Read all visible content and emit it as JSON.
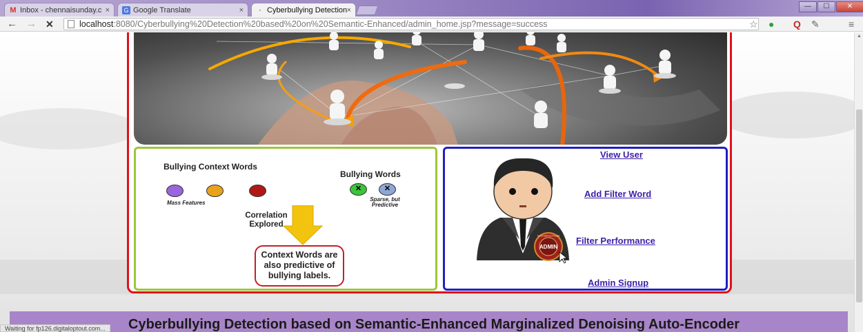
{
  "browser": {
    "tabs": [
      {
        "label": "Inbox - chennaisunday.c",
        "icon": "gmail-icon"
      },
      {
        "label": "Google Translate",
        "icon": "translate-icon"
      },
      {
        "label": "Cyberbullying Detection",
        "icon": "page-icon"
      }
    ],
    "tab_close": "×",
    "back": "←",
    "forward": "→",
    "stop": "✕",
    "url_host": "localhost",
    "url_path": ":8080/Cyberbullying%20Detection%20based%20on%20Semantic-Enhanced/admin_home.jsp?message=success",
    "window_controls": {
      "minimize": "—",
      "maximize": "☐",
      "close": "✕"
    },
    "status_text": "Waiting for fp126.digitaloptout.com..."
  },
  "diagram": {
    "context_words_title": "Bullying Context Words",
    "bullying_words_title": "Bullying Words",
    "mass_features": "Mass Features",
    "sparse_predictive": "Sparse, but Predictive",
    "correlation": "Correlation Explored",
    "context_box": "Context Words are also predictive of bullying labels.",
    "circle_colors": [
      "#9966dd",
      "#e8a21c",
      "#b01818"
    ],
    "word_colors": [
      "#3cc43c",
      "#8fa6d6"
    ],
    "arrow_color": "#f2c40f"
  },
  "admin": {
    "links": {
      "view_user": "View User",
      "add_filter": "Add Filter Word",
      "filter_perf": "Filter Performance",
      "signup": "Admin Signup"
    },
    "badge": "ADMIN",
    "badge_ring": "SATISFACTION"
  },
  "footer": {
    "title": "Cyberbullying Detection based on Semantic-Enhanced Marginalized Denoising Auto-Encoder"
  },
  "colors": {
    "frame": "#e0101a",
    "left_panel": "#9dc63a",
    "right_panel": "#1f1fc4",
    "link": "#3b1fa8",
    "footer_bg": "#a885c8"
  }
}
